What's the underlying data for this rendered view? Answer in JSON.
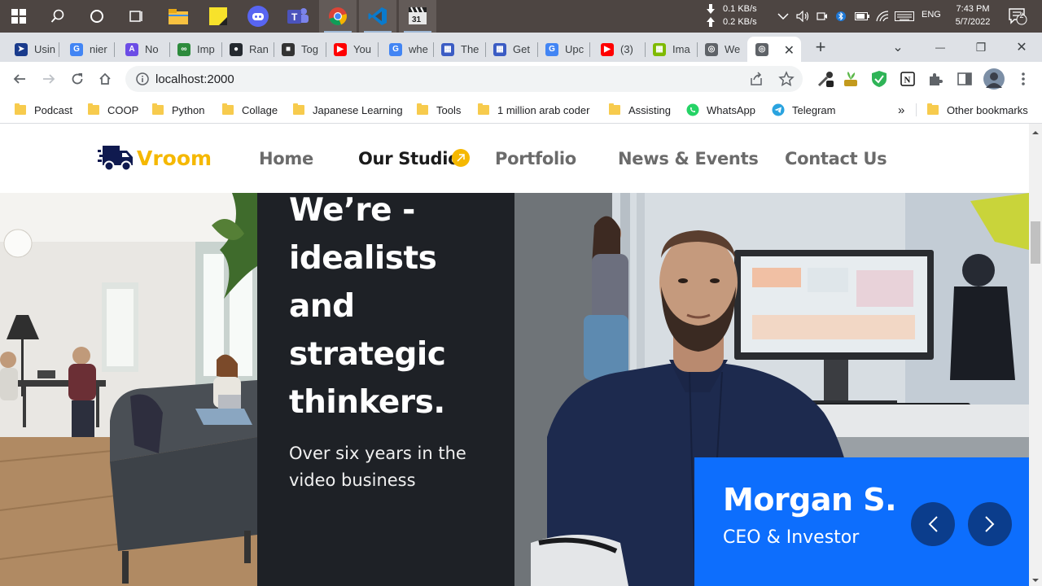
{
  "taskbar": {
    "net_down": "0.1 KB/s",
    "net_up": "0.2 KB/s",
    "language": "ENG",
    "time": "7:43 PM",
    "date": "5/7/2022",
    "notifications": "2",
    "apps": [
      "windows-start",
      "search",
      "cortana",
      "task-view",
      "file-explorer",
      "sticky-notes",
      "discord",
      "teams",
      "chrome",
      "vscode",
      "clapper"
    ]
  },
  "tabs": [
    {
      "title": "Usin",
      "icon": "arrow-icon",
      "color": "#1a3b8c"
    },
    {
      "title": "nier",
      "icon": "google-icon",
      "color": "#4285f4"
    },
    {
      "title": "No",
      "icon": "notion-ai-icon",
      "color": "#6c4de6"
    },
    {
      "title": "Imp",
      "icon": "link-icon",
      "color": "#2d8b3c"
    },
    {
      "title": "Ran",
      "icon": "github-icon",
      "color": "#24292f"
    },
    {
      "title": "Tog",
      "icon": "avatar-icon",
      "color": "#333333"
    },
    {
      "title": "You",
      "icon": "youtube-icon",
      "color": "#ff0000"
    },
    {
      "title": "whe",
      "icon": "google-icon",
      "color": "#4285f4"
    },
    {
      "title": "The",
      "icon": "grid-icon",
      "color": "#3b5cc4"
    },
    {
      "title": "Get",
      "icon": "grid-icon",
      "color": "#3b5cc4"
    },
    {
      "title": "Upc",
      "icon": "google-icon",
      "color": "#4285f4"
    },
    {
      "title": "(3)",
      "icon": "youtube-icon",
      "color": "#ff0000"
    },
    {
      "title": "Ima",
      "icon": "microsoft-icon",
      "color": "#7fba00"
    },
    {
      "title": "We",
      "icon": "globe-icon",
      "color": "#5f6368"
    },
    {
      "title": "",
      "icon": "globe-icon",
      "color": "#5f6368"
    }
  ],
  "browser": {
    "url": "localhost:2000"
  },
  "bookmarks": [
    {
      "label": "Podcast",
      "icon": "folder"
    },
    {
      "label": "COOP",
      "icon": "folder"
    },
    {
      "label": "Python",
      "icon": "folder"
    },
    {
      "label": "Collage",
      "icon": "folder"
    },
    {
      "label": "Japanese Learning",
      "icon": "folder"
    },
    {
      "label": "Tools",
      "icon": "folder"
    },
    {
      "label": "1 million arab coder",
      "icon": "folder"
    },
    {
      "label": "Assisting",
      "icon": "folder"
    },
    {
      "label": "WhatsApp",
      "icon": "whatsapp"
    },
    {
      "label": "Telegram",
      "icon": "telegram"
    }
  ],
  "bookmarks_overflow": "»",
  "other_bookmarks": "Other bookmarks",
  "site": {
    "brand": "Vroom",
    "nav": [
      "Home",
      "Our Studio",
      "Portfolio",
      "News & Events",
      "Contact Us"
    ],
    "active_nav": "Our Studio",
    "headline": [
      "We’re -",
      "idealists",
      "and",
      "strategic",
      "thinkers."
    ],
    "tagline": "Over six years in the video business",
    "profile": {
      "name": "Morgan S.",
      "role": "CEO & Investor"
    }
  },
  "colors": {
    "accent": "#f5b800",
    "brand_blue": "#0d6efd",
    "dark_panel": "#1e2126"
  }
}
